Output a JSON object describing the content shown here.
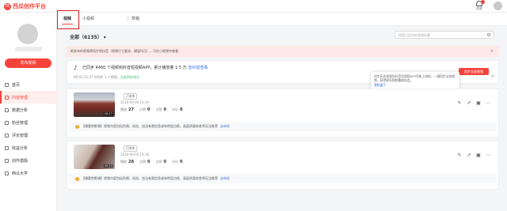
{
  "app": {
    "logo_mark": "西",
    "logo_text": "西瓜创作平台"
  },
  "header": {
    "message_label": "消息"
  },
  "sidebar": {
    "publish_label": "发布视频",
    "items": [
      {
        "label": "首页",
        "active": false
      },
      {
        "label": "内容管理",
        "active": true
      },
      {
        "label": "数据分析",
        "active": false
      },
      {
        "label": "粉丝管理",
        "active": false
      },
      {
        "label": "评论管理",
        "active": false
      },
      {
        "label": "收益分析",
        "active": false
      },
      {
        "label": "创作激励",
        "active": false
      },
      {
        "label": "西瓜大学",
        "active": false
      }
    ]
  },
  "tabs": [
    {
      "label": "视频",
      "active": true
    },
    {
      "label": "小视频",
      "active": false
    },
    {
      "label": "草稿",
      "active": false
    }
  ],
  "filter": {
    "label": "全部（6135）",
    "caret": "▾"
  },
  "search": {
    "placeholder": "搜索已发布的视频标题"
  },
  "notice_top": {
    "text": "新发布的视频将同步到抖音（视频尺寸要求，横竖均可），可在小视频中查看",
    "close": "×"
  },
  "sync": {
    "icon": "♪",
    "main": "已同步 4460 个视频到抖音短视频APP，累计播放量 1.5 万",
    "link": "去抖音查看",
    "status_prefix": "06-03 22:27 共同步 1 个视频，",
    "status_ok": "全部同步成功",
    "button": "同步全部视频",
    "close": "×"
  },
  "tooltip": {
    "text": "同步历史视频到抖音短视频APP可能上线前，一键同步全部视频，获得更多视频播放机会。",
    "link": "我知道了"
  },
  "videos": [
    {
      "title": "",
      "status": "已发布",
      "date": "2020-09-06 14:39",
      "duration": "00:17",
      "stats": [
        {
          "label": "播放",
          "value": "27"
        },
        {
          "label": "点赞",
          "value": "0"
        },
        {
          "label": "点赞",
          "value": "0"
        },
        {
          "label": "评论",
          "value": "0"
        }
      ],
      "warn_text": "【播客剪影辑】视频内容包括色情、低俗、违法有害信息或有明显边框，画面质量较差将无法推荐",
      "warn_link": "去申诉"
    },
    {
      "title": "",
      "status": "已发布",
      "date": "2020-09-06 14:38",
      "duration": "00:13",
      "stats": [
        {
          "label": "播放",
          "value": "28"
        },
        {
          "label": "点赞",
          "value": "0"
        },
        {
          "label": "点赞",
          "value": "0"
        },
        {
          "label": "评论",
          "value": "0"
        }
      ],
      "warn_text": "【播客剪影辑】视频内容包括色情、低俗、违法有害信息或有明显边框，画面质量较差将无法推荐",
      "warn_link": "去申诉"
    }
  ],
  "icons": [
    "edit-icon",
    "share-icon",
    "chart-icon",
    "more-icon"
  ],
  "colors": {
    "accent": "#f5433b",
    "link": "#2d6be0",
    "success": "#2ebd6b"
  }
}
